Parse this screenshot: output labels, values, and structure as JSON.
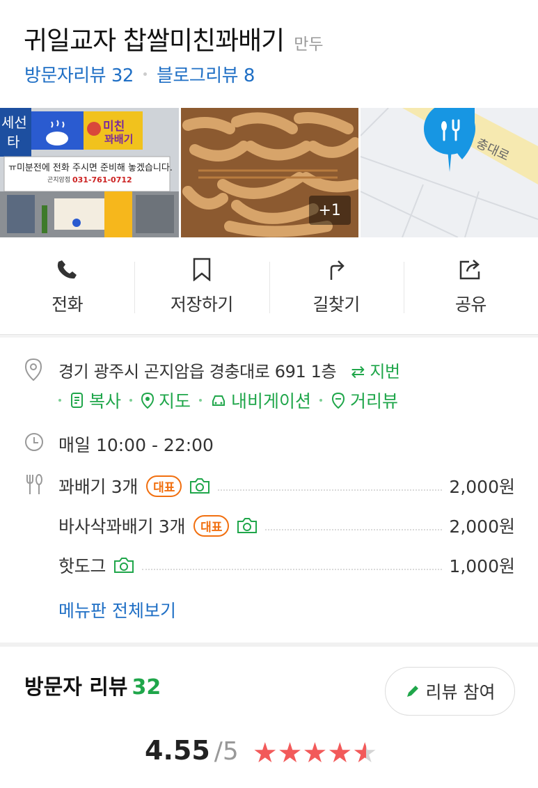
{
  "place": {
    "name": "귀일교자 찹쌀미친꽈배기",
    "category": "만두",
    "visitor_review_label": "방문자리뷰 32",
    "blog_review_label": "블로그리뷰 8"
  },
  "photos": {
    "more_count": "+1",
    "storefront_sign_1": "미친",
    "storefront_sign_2": "꽈배기",
    "banner_text": "ㅠ미분전에 전화 주시면 준비해 놓겠습니다.",
    "banner_sub": "곤지암점",
    "banner_phone": "031-761-0712",
    "map_road_label": "충대로",
    "edge_sign": "세선\n타"
  },
  "actions": [
    {
      "label": "전화",
      "icon": "phone-icon"
    },
    {
      "label": "저장하기",
      "icon": "bookmark-icon"
    },
    {
      "label": "길찾기",
      "icon": "directions-icon"
    },
    {
      "label": "공유",
      "icon": "share-icon"
    }
  ],
  "address": {
    "text": "경기 광주시 곤지암읍 경충대로 691 1층",
    "jibun_label": "지번",
    "links": [
      "복사",
      "지도",
      "내비게이션",
      "거리뷰"
    ]
  },
  "hours": "매일 10:00 - 22:00",
  "menu": {
    "items": [
      {
        "name": "꽈배기 3개",
        "badge": "대표",
        "price": "2,000원"
      },
      {
        "name": "바사삭꽈배기 3개",
        "badge": "대표",
        "price": "2,000원"
      },
      {
        "name": "핫도그",
        "badge": "",
        "price": "1,000원"
      }
    ],
    "view_all_label": "메뉴판 전체보기"
  },
  "reviews": {
    "title": "방문자 리뷰",
    "count": "32",
    "write_label": "리뷰 참여",
    "score": "4.55",
    "max": "/5",
    "rating_value": 4.55
  },
  "colors": {
    "link_blue": "#1f6fc5",
    "green": "#1fa64a",
    "badge_orange": "#f16f0f",
    "star_red": "#f25a5a"
  }
}
